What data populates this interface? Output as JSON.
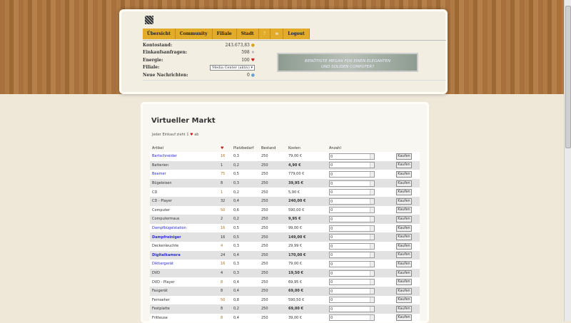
{
  "nav": [
    "Übersicht",
    "Community",
    "Filiale",
    "Stadt",
    "?",
    "≡",
    "Logout"
  ],
  "info": [
    {
      "label": "Kontostand:",
      "value": "243.673,83",
      "icon": "coin-icon"
    },
    {
      "label": "Einkaufsanfragen:",
      "value": "598",
      "icon": "star-icon"
    },
    {
      "label": "Energie:",
      "value": "100",
      "icon": "heart-icon"
    },
    {
      "label": "Filiale:",
      "value": "Media Center (aktiv)",
      "icon": "dropdown"
    },
    {
      "label": "Neue Nachrichten:",
      "value": "0",
      "icon": "mail-icon"
    }
  ],
  "banner": {
    "line1": "BENÖTIGTE MEGAN FOX EINEN ELEGANTEN",
    "line2": "UND SOLIDEN COMPUTER?"
  },
  "market": {
    "title": "Virtueller Markt",
    "note_pre": "Jeder Einkauf zieht 1",
    "note_post": "ab",
    "headers": [
      "Artikel",
      "♥",
      "Platzbedarf",
      "Bestand",
      "Kosten",
      "Anzahl"
    ],
    "buy_label": "Kaufen",
    "rows": [
      {
        "name": "Bartschneider",
        "e": "16",
        "p": "0,3",
        "b": "250",
        "k": "79,00 €",
        "q": "0",
        "link": true
      },
      {
        "name": "Batterien",
        "e": "1",
        "p": "0,2",
        "b": "250",
        "k": "4,90 €",
        "q": "0"
      },
      {
        "name": "Beamer",
        "e": "75",
        "p": "0,5",
        "b": "250",
        "k": "779,00 €",
        "q": "0",
        "link": true
      },
      {
        "name": "Bügeleisen",
        "e": "8",
        "p": "0,3",
        "b": "250",
        "k": "39,95 €",
        "q": "0"
      },
      {
        "name": "CD",
        "e": "1",
        "p": "0,2",
        "b": "250",
        "k": "5,90 €",
        "q": "0"
      },
      {
        "name": "CD - Player",
        "e": "32",
        "p": "0,4",
        "b": "250",
        "k": "240,00 €",
        "q": "0"
      },
      {
        "name": "Computer",
        "e": "50",
        "p": "0,6",
        "b": "250",
        "k": "590,00 €",
        "q": "0"
      },
      {
        "name": "Computermaus",
        "e": "2",
        "p": "0,2",
        "b": "250",
        "k": "9,95 €",
        "q": "0"
      },
      {
        "name": "Dampfbügelstation",
        "e": "16",
        "p": "0,5",
        "b": "250",
        "k": "99,00 €",
        "q": "0",
        "link": true
      },
      {
        "name": "Dampfreiniger",
        "e": "16",
        "p": "0,5",
        "b": "250",
        "k": "149,00 €",
        "q": "0",
        "link": true,
        "bold": true
      },
      {
        "name": "Deckenleuchte",
        "e": "4",
        "p": "0,3",
        "b": "250",
        "k": "29,99 €",
        "q": "0"
      },
      {
        "name": "Digitalkamera",
        "e": "24",
        "p": "0,4",
        "b": "250",
        "k": "170,00 €",
        "q": "0",
        "link": true,
        "bold": true
      },
      {
        "name": "Diktiergerät",
        "e": "16",
        "p": "0,3",
        "b": "250",
        "k": "79,00 €",
        "q": "0",
        "link": true
      },
      {
        "name": "DVD",
        "e": "4",
        "p": "0,3",
        "b": "250",
        "k": "19,50 €",
        "q": "0"
      },
      {
        "name": "DVD - Player",
        "e": "8",
        "p": "0,4",
        "b": "250",
        "k": "69,95 €",
        "q": "0"
      },
      {
        "name": "Faxgerät",
        "e": "8",
        "p": "0,4",
        "b": "250",
        "k": "69,00 €",
        "q": "0"
      },
      {
        "name": "Fernseher",
        "e": "50",
        "p": "0,8",
        "b": "250",
        "k": "590,50 €",
        "q": "0"
      },
      {
        "name": "Festplatte",
        "e": "8",
        "p": "0,2",
        "b": "250",
        "k": "69,00 €",
        "q": "0"
      },
      {
        "name": "Fritteuse",
        "e": "8",
        "p": "0,4",
        "b": "250",
        "k": "39,00 €",
        "q": "0"
      }
    ]
  }
}
